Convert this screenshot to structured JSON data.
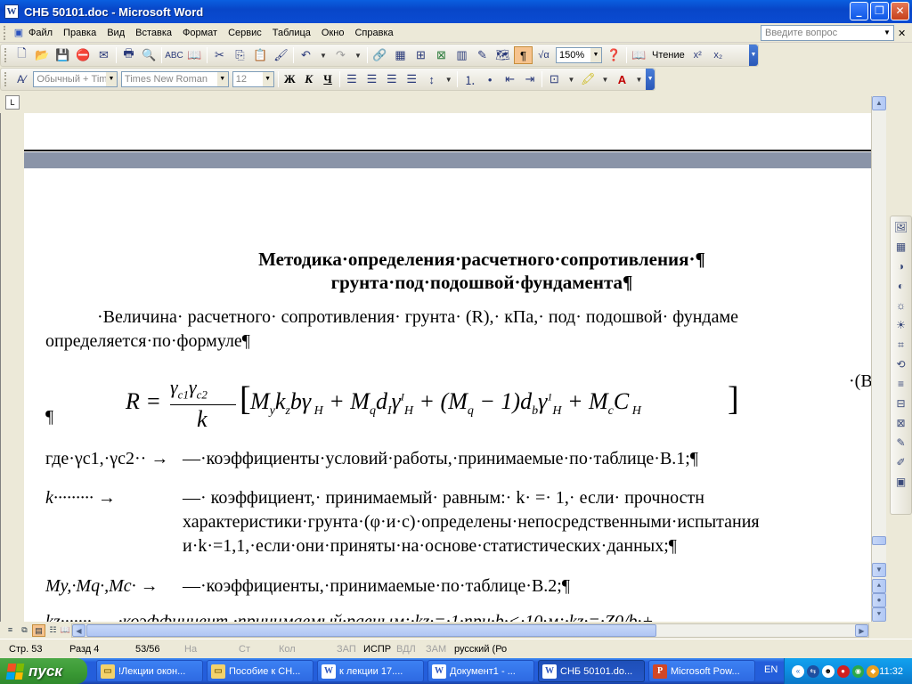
{
  "window": {
    "title": "СНБ 50101.doc - Microsoft Word"
  },
  "menu": {
    "items": [
      "Файл",
      "Правка",
      "Вид",
      "Вставка",
      "Формат",
      "Сервис",
      "Таблица",
      "Окно",
      "Справка"
    ],
    "help_placeholder": "Введите вопрос"
  },
  "toolbar": {
    "zoom": "150%",
    "reading": "Чтение"
  },
  "formatting": {
    "style": "Обычный + Time",
    "font": "Times New Roman",
    "size": "12",
    "bold": "Ж",
    "italic": "К",
    "underline": "Ч"
  },
  "document": {
    "title_line1": "Методика·определения·расчетного·сопротивления·¶",
    "title_line2": "грунта·под·подошвой·фундамента¶",
    "para1": "·Величина· расчетного· сопротивления· грунта· (R),· кПа,· под· подошвой· фундаме",
    "para1b": "определяется·по·формуле¶",
    "eq_ref": "·(В",
    "pilcrow": "¶",
    "def1_sym": "где·γc1,·γc2·· →",
    "def1_text": "—·коэффициенты·условий·работы,·принимаемые·по·таблице·В.1;¶",
    "def2_sym": "k·········  →",
    "def2_text1": "—· коэффициент,· принимаемый· равным:· k· =· 1,· если· прочностн",
    "def2_text2": "характеристики·грунта·(φ·и·с)·определены·непосредственными·испытания",
    "def2_text3": "и·k·=1,1,·если·они·приняты·на·основе·статистических·данных;¶",
    "def3_sym": "My,·Mq·,Mc·  →",
    "def3_text": "—·коэффициенты,·принимаемые·по·таблице·В.2;¶",
    "def4_partial": "kz·······  →  ·коэффициент,·принимаемый·равным:·kz·=·1·при·b·<·10·м;·kz·=·Z0/b·+"
  },
  "status": {
    "page": "Стр. 53",
    "section": "Разд  4",
    "pages": "53/56",
    "at": "На",
    "line": "Ст",
    "col": "Кол",
    "rec": "ЗАП",
    "trk": "ИСПР",
    "ext": "ВДЛ",
    "ovr": "ЗАМ",
    "lang": "русский (Ро"
  },
  "taskbar": {
    "start": "пуск",
    "tasks": [
      "!Лекции окон...",
      "Пособие к СН...",
      "к лекции 17....",
      "Документ1 - ...",
      "СНБ 50101.do...",
      "Microsoft Pow..."
    ],
    "lang": "EN",
    "clock": "11:32"
  }
}
